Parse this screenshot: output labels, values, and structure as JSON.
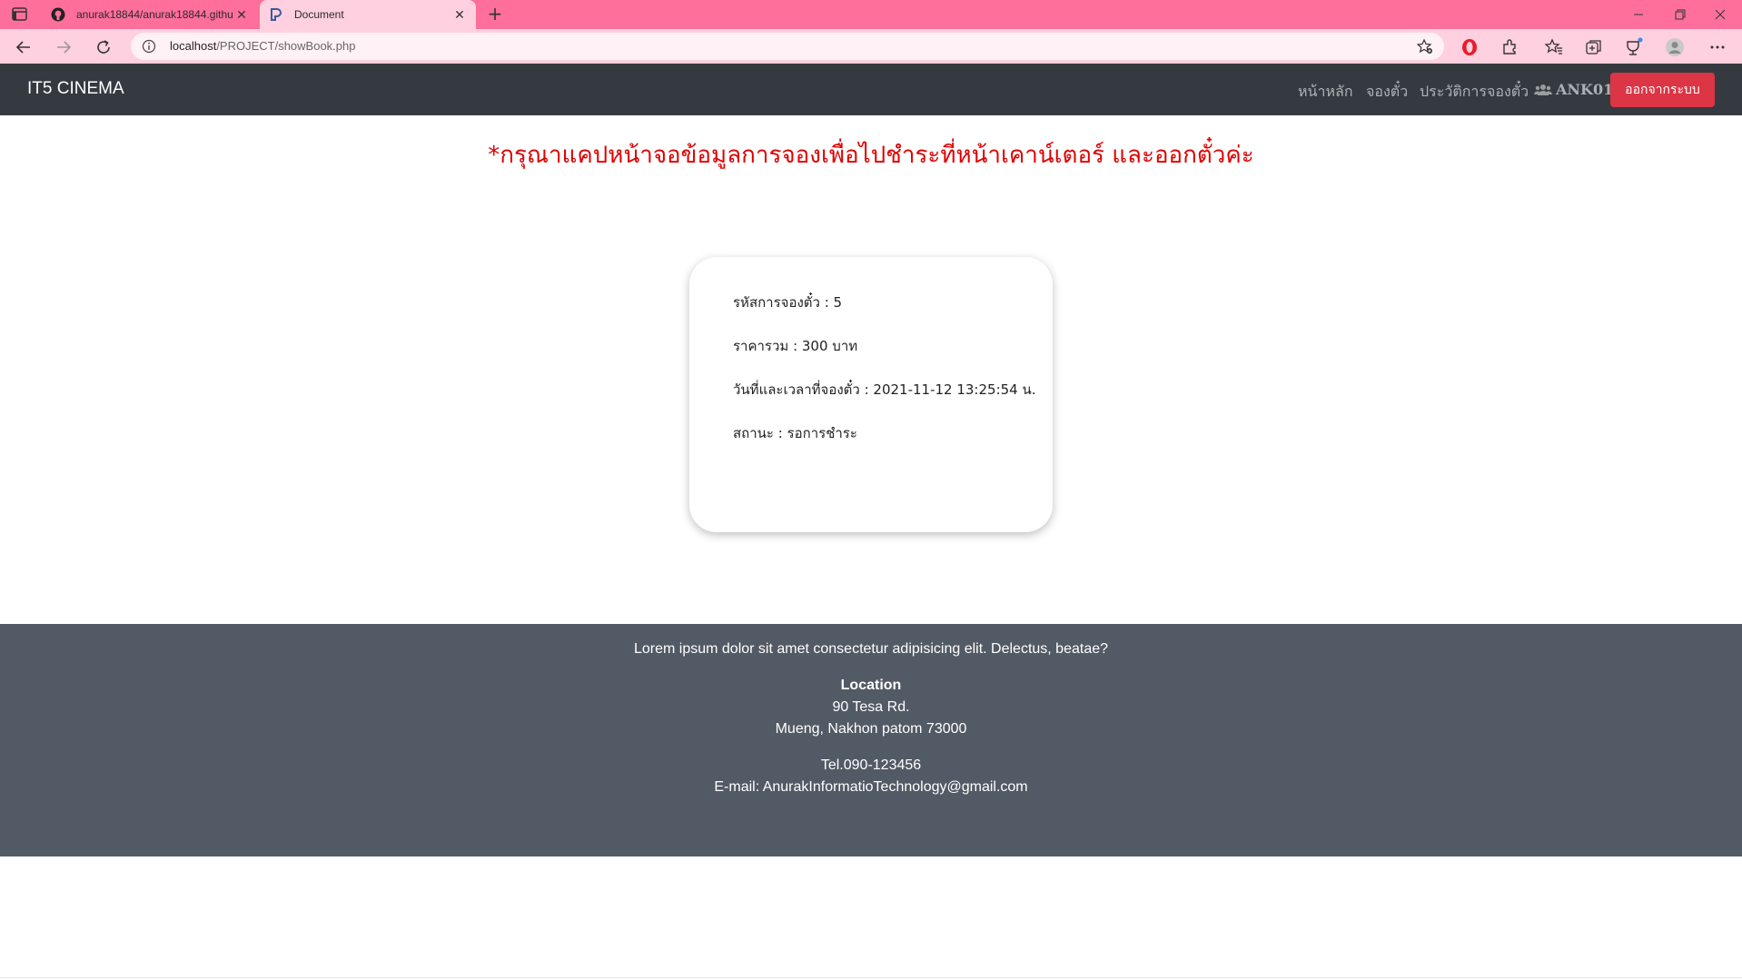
{
  "browser": {
    "tabs": [
      {
        "label": "anurak18844/anurak18844.githu",
        "icon": "github-icon",
        "active": false
      },
      {
        "label": "Document",
        "icon": "page-icon",
        "active": true
      }
    ],
    "address": {
      "host": "localhost",
      "path": "/PROJECT/showBook.php"
    },
    "colors": {
      "tabbar": "#ff6f9c",
      "toolbar": "#ffd0df"
    }
  },
  "navbar": {
    "brand": "IT5 CINEMA",
    "links": [
      "หน้าหลัก",
      "จองตั๋ว",
      "ประวัติการจองตั๋ว"
    ],
    "user": "ANK01",
    "logout": "ออกจากระบบ"
  },
  "notice": "*กรุณาแคปหน้าจอข้อมูลการจองเพื่อไปชำระที่หน้าเคาน์เตอร์ และออกตั๋วค่ะ",
  "booking": {
    "id_line": "รหัสการจองตั๋ว : 5",
    "price_line": "ราคารวม : 300 บาท",
    "datetime_line": "วันที่และเวลาที่จองตั๋ว : 2021-11-12 13:25:54 น.",
    "status_line": "สถานะ : รอการชำระ"
  },
  "footer": {
    "tagline": "Lorem ipsum dolor sit amet consectetur adipisicing elit. Delectus, beatae?",
    "location_title": "Location",
    "address1": "90 Tesa Rd.",
    "address2": "Mueng, Nakhon patom 73000",
    "tel": "Tel.090-123456",
    "email": "E-mail: AnurakInformatioTechnology@gmail.com"
  }
}
